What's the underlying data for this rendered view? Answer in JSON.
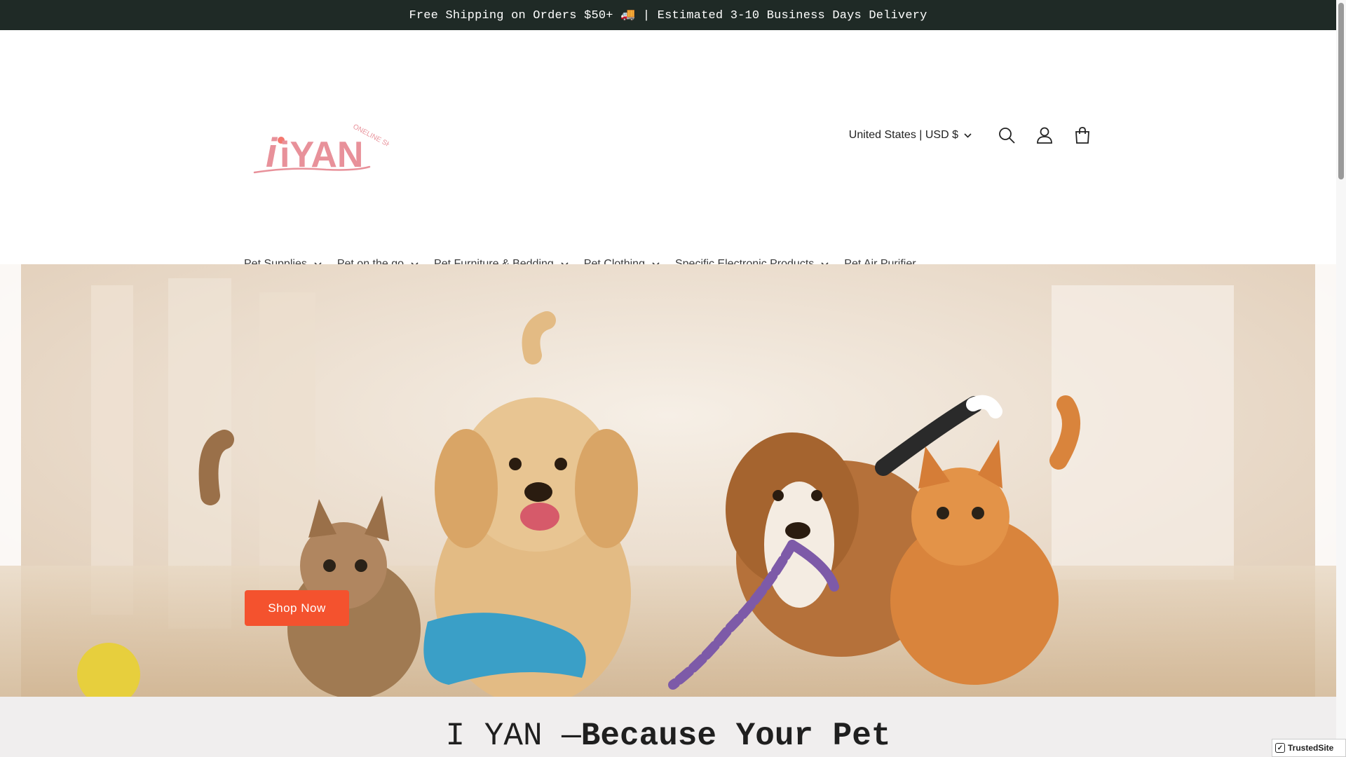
{
  "announcement": {
    "text": "Free Shipping on Orders $50+ 🚚 | Estimated 3-10 Business Days Delivery"
  },
  "header": {
    "logo": {
      "text": "iYAN",
      "tagline": "ONELINE SHOP"
    },
    "country_selector": "United States | USD $",
    "icons": [
      "search-icon",
      "account-icon",
      "cart-icon"
    ]
  },
  "nav": {
    "items": [
      {
        "label": "Pet Supplies",
        "has_dropdown": true
      },
      {
        "label": "Pet on the go",
        "has_dropdown": true
      },
      {
        "label": "Pet Furniture & Bedding",
        "has_dropdown": true
      },
      {
        "label": "Pet Clothing",
        "has_dropdown": true
      },
      {
        "label": "Specific Electronic Products",
        "has_dropdown": true
      },
      {
        "label": "Pet Air Purifier",
        "has_dropdown": false
      }
    ]
  },
  "hero": {
    "button_label": "Shop Now"
  },
  "intro": {
    "heading_light": "I YAN —",
    "heading_bold": "Because Your Pet"
  },
  "badge": {
    "label": "TrustedSite"
  },
  "colors": {
    "announcement_bg": "#1f2a26",
    "accent": "#f4522e",
    "logo_pink": "#e8919a",
    "intro_bg": "#f0eeee"
  }
}
